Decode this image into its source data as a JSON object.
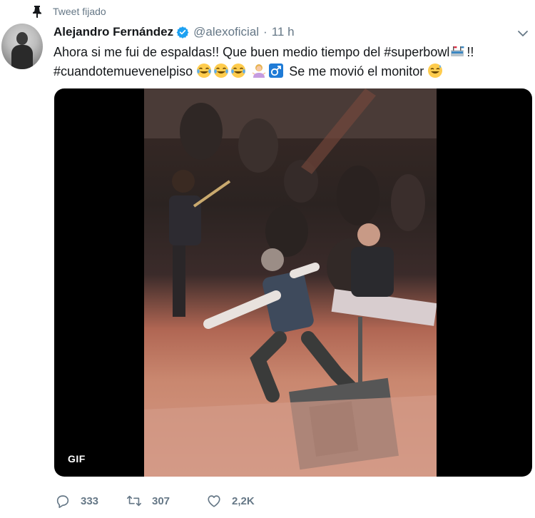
{
  "pinned": {
    "label": "Tweet fijado",
    "icon": "pin-icon"
  },
  "author": {
    "name": "Alejandro Fernández",
    "handle": "@alexoficial",
    "separator": "·",
    "time": "11 h",
    "verified_icon": "verified-badge-icon"
  },
  "tweet": {
    "line1": "Ahora si me fui de espaldas!! Que buen medio tiempo del #superbowl",
    "line1_suffix": "!!",
    "line2_hashtag": "#cuandotemuevenelpiso",
    "line2_after": " Se me movió el monitor",
    "emoji_names": [
      "stadium-emoji",
      "joy-emoji",
      "joy-emoji",
      "joy-emoji",
      "woman-shrugging-emoji",
      "male-sign-emoji",
      "sweat-smile-emoji"
    ]
  },
  "media": {
    "badge": "GIF"
  },
  "actions": {
    "replies": "333",
    "retweets": "307",
    "likes": "2,2K"
  },
  "colors": {
    "accent": "#1da1f2",
    "muted": "#657786",
    "text": "#14171a",
    "male_sign_bg": "#1f7bd6"
  }
}
